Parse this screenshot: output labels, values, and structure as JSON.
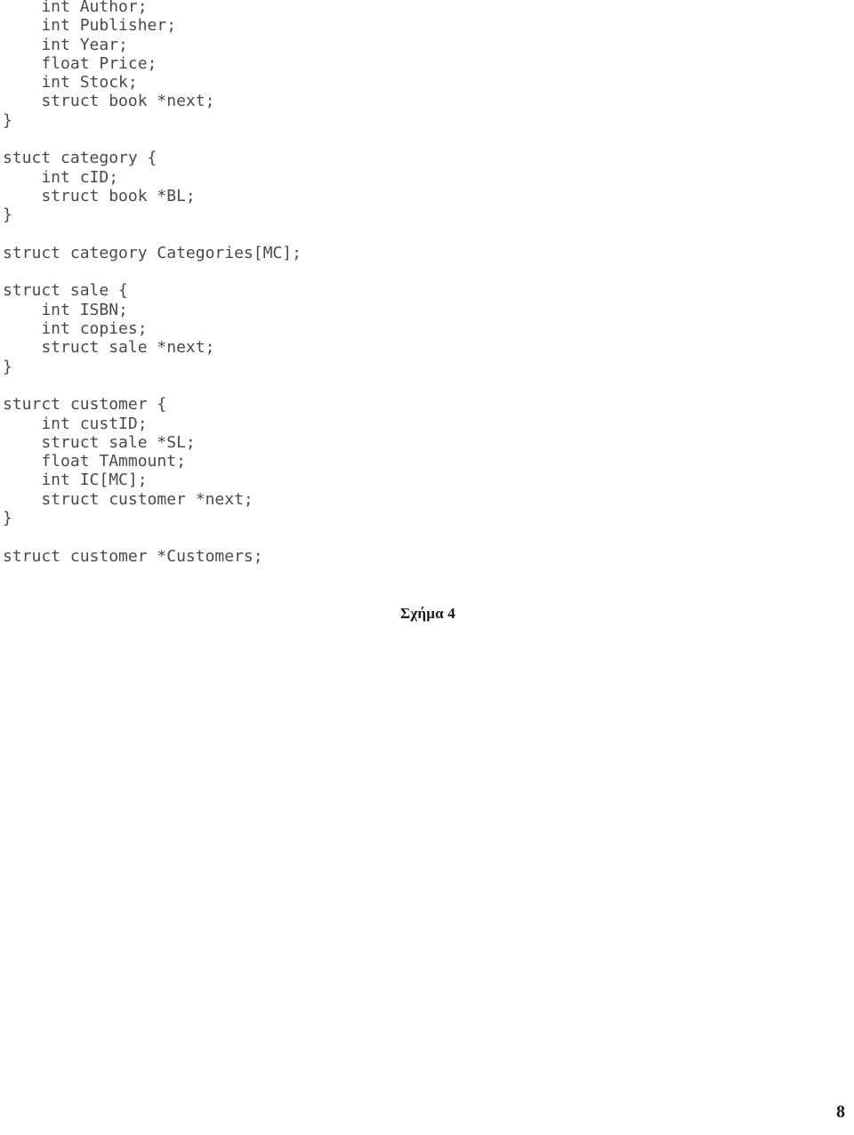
{
  "document": {
    "page_number": "8",
    "figure_caption": "Σχήμα 4"
  },
  "code": {
    "language": "c",
    "lines": [
      "    int Author;",
      "    int Publisher;",
      "    int Year;",
      "    float Price;",
      "    int Stock;",
      "    struct book *next;",
      "}",
      "",
      "stuct category {",
      "    int cID;",
      "    struct book *BL;",
      "}",
      "",
      "struct category Categories[MC];",
      "",
      "struct sale {",
      "    int ISBN;",
      "    int copies;",
      "    struct sale *next;",
      "}",
      "",
      "sturct customer {",
      "    int custID;",
      "    struct sale *SL;",
      "    float TAmmount;",
      "    int IC[MC];",
      "    struct customer *next;",
      "}",
      "",
      "struct customer *Customers;"
    ]
  }
}
